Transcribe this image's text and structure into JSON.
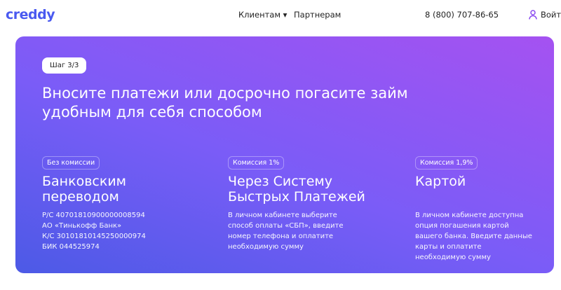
{
  "header": {
    "logo": "creddy",
    "nav": [
      {
        "label": "Клиентам ▾"
      },
      {
        "label": "Партнерам"
      }
    ],
    "phone": "8 (800) 707-86-65",
    "login": "Войти"
  },
  "hero": {
    "step": "Шаг 3/3",
    "title": "Вносите платежи или досрочно погасите займ удобным для себя способом",
    "methods": [
      {
        "badge": "Без комиссии",
        "title": "Банковским переводом",
        "lines": [
          "Р/С 40701810900000008594",
          "АО «Тинькофф Банк»",
          "К/С 30101810145250000974",
          "БИК 044525974"
        ]
      },
      {
        "badge": "Комиссия 1%",
        "title": "Через Систему Быстрых Платежей",
        "text": "В личном кабинете выберите способ оплаты «СБП», введите номер телефона и оплатите необходимую сумму"
      },
      {
        "badge": "Комиссия 1,9%",
        "title": "Картой",
        "text": "В личном кабинете доступна опция погашения картой вашего банка. Введите данные карты и оплатите необходимую сумму"
      }
    ]
  },
  "colors": {
    "brand": "#4a5af0",
    "gradient_start": "#4c5ae6",
    "gradient_end": "#a552f1"
  }
}
